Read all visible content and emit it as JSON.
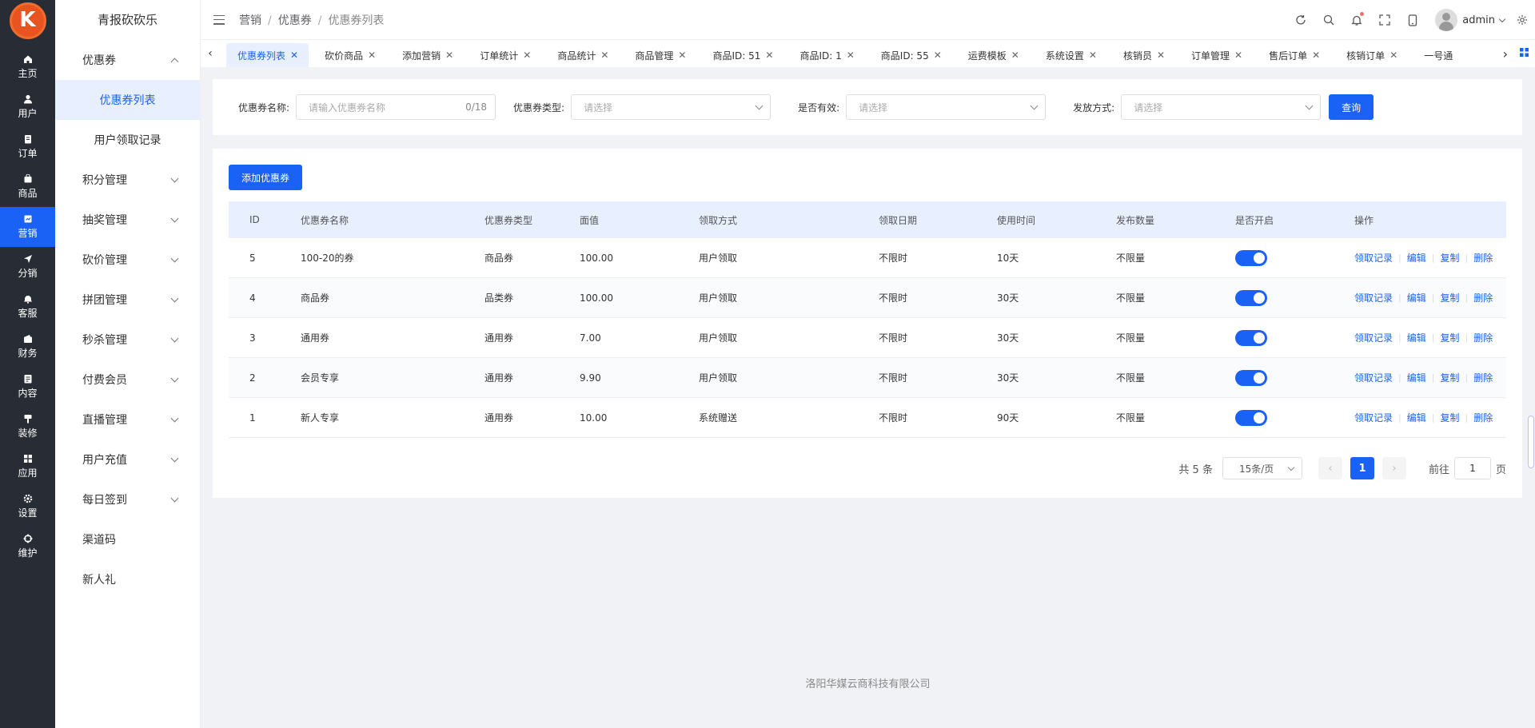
{
  "app": {
    "logo_letter": "K",
    "title": "青报砍砍乐"
  },
  "rail": [
    {
      "label": "主页",
      "icon": "home-icon"
    },
    {
      "label": "用户",
      "icon": "user-icon"
    },
    {
      "label": "订单",
      "icon": "order-icon"
    },
    {
      "label": "商品",
      "icon": "goods-icon"
    },
    {
      "label": "营销",
      "icon": "marketing-icon",
      "active": true
    },
    {
      "label": "分销",
      "icon": "distribution-icon"
    },
    {
      "label": "客服",
      "icon": "service-icon"
    },
    {
      "label": "财务",
      "icon": "finance-icon"
    },
    {
      "label": "内容",
      "icon": "content-icon"
    },
    {
      "label": "装修",
      "icon": "decorate-icon"
    },
    {
      "label": "应用",
      "icon": "apps-icon"
    },
    {
      "label": "设置",
      "icon": "settings-icon"
    },
    {
      "label": "维护",
      "icon": "maintain-icon"
    }
  ],
  "submenu": [
    {
      "label": "优惠券",
      "expanded": true
    },
    {
      "label": "优惠券列表",
      "child": true,
      "active": true
    },
    {
      "label": "用户领取记录",
      "child": true
    },
    {
      "label": "积分管理"
    },
    {
      "label": "抽奖管理"
    },
    {
      "label": "砍价管理"
    },
    {
      "label": "拼团管理"
    },
    {
      "label": "秒杀管理"
    },
    {
      "label": "付费会员"
    },
    {
      "label": "直播管理"
    },
    {
      "label": "用户充值"
    },
    {
      "label": "每日签到"
    },
    {
      "label": "渠道码",
      "leaf": true
    },
    {
      "label": "新人礼",
      "leaf": true
    }
  ],
  "breadcrumb": [
    "营销",
    "优惠券",
    "优惠券列表"
  ],
  "header": {
    "username": "admin"
  },
  "tabs": [
    "优惠券列表",
    "砍价商品",
    "添加营销",
    "订单统计",
    "商品统计",
    "商品管理",
    "商品ID: 51",
    "商品ID: 1",
    "商品ID: 55",
    "运费模板",
    "系统设置",
    "核销员",
    "订单管理",
    "售后订单",
    "核销订单",
    "一号通"
  ],
  "filter": {
    "name_label": "优惠券名称:",
    "name_placeholder": "请输入优惠券名称",
    "name_count": "0/18",
    "type_label": "优惠券类型:",
    "type_placeholder": "请选择",
    "valid_label": "是否有效:",
    "valid_placeholder": "请选择",
    "issue_label": "发放方式:",
    "issue_placeholder": "请选择",
    "query_button": "查询"
  },
  "add_button": "添加优惠券",
  "table": {
    "columns": [
      "ID",
      "优惠券名称",
      "优惠券类型",
      "面值",
      "领取方式",
      "领取日期",
      "使用时间",
      "发布数量",
      "是否开启",
      "操作"
    ],
    "rows": [
      {
        "id": "5",
        "name": "100-20的券",
        "type": "商品券",
        "value": "100.00",
        "method": "用户领取",
        "date": "不限时",
        "usage": "10天",
        "quantity": "不限量",
        "enabled": true
      },
      {
        "id": "4",
        "name": "商品券",
        "type": "品类券",
        "value": "100.00",
        "method": "用户领取",
        "date": "不限时",
        "usage": "30天",
        "quantity": "不限量",
        "enabled": true
      },
      {
        "id": "3",
        "name": "通用券",
        "type": "通用券",
        "value": "7.00",
        "method": "用户领取",
        "date": "不限时",
        "usage": "30天",
        "quantity": "不限量",
        "enabled": true
      },
      {
        "id": "2",
        "name": "会员专享",
        "type": "通用券",
        "value": "9.90",
        "method": "用户领取",
        "date": "不限时",
        "usage": "30天",
        "quantity": "不限量",
        "enabled": true
      },
      {
        "id": "1",
        "name": "新人专享",
        "type": "通用券",
        "value": "10.00",
        "method": "系统赠送",
        "date": "不限时",
        "usage": "90天",
        "quantity": "不限量",
        "enabled": true
      }
    ],
    "actions": [
      "领取记录",
      "编辑",
      "复制",
      "删除"
    ]
  },
  "pagination": {
    "total": "共 5 条",
    "page_size": "15条/页",
    "current": "1",
    "goto_label": "前往",
    "goto_value": "1",
    "page_unit": "页"
  },
  "footer": "洛阳华媒云商科技有限公司",
  "colors": {
    "primary": "#1a62f5",
    "rail_bg": "#282c34",
    "logo": "#e8541f"
  }
}
